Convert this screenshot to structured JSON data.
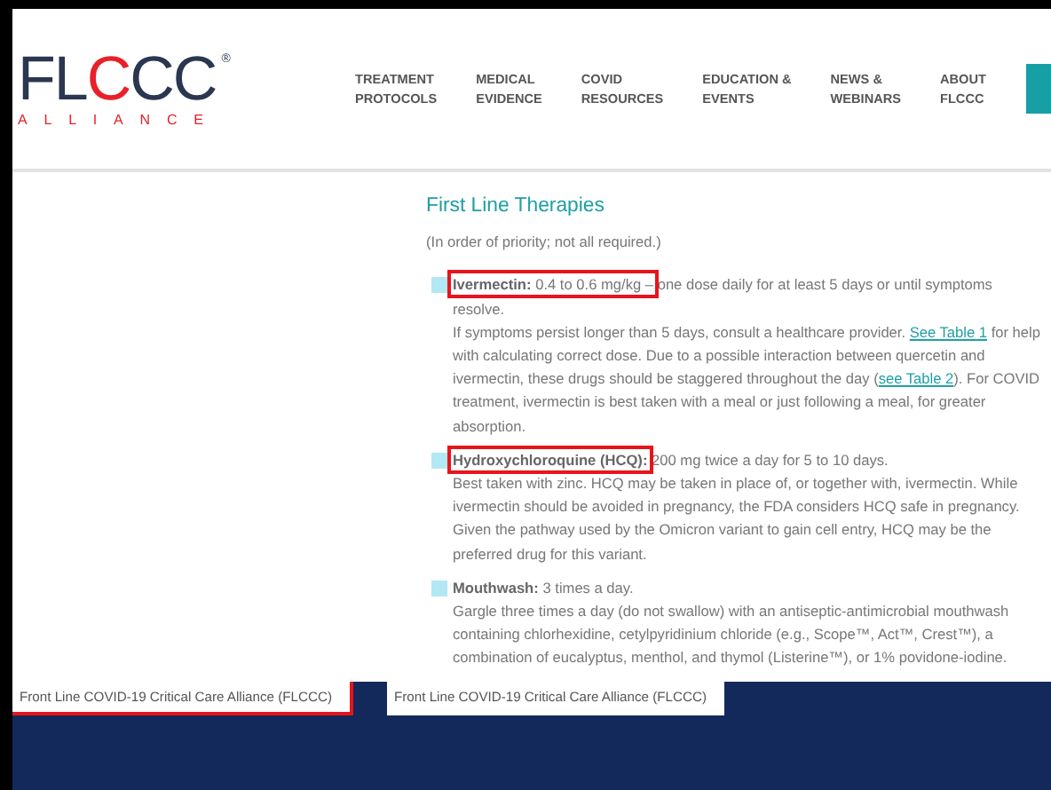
{
  "logo": {
    "wordmark_start": "FL",
    "wordmark_accent": "C",
    "wordmark_end": "CC",
    "registered": "®",
    "tagline": "ALLIANCE"
  },
  "nav": [
    {
      "line1": "TREATMENT",
      "line2": "PROTOCOLS"
    },
    {
      "line1": "MEDICAL",
      "line2": "EVIDENCE"
    },
    {
      "line1": "COVID",
      "line2": "RESOURCES"
    },
    {
      "line1": "EDUCATION &",
      "line2": "EVENTS"
    },
    {
      "line1": "NEWS &",
      "line2": "WEBINARS"
    },
    {
      "line1": "ABOUT",
      "line2": "FLCCC"
    }
  ],
  "section": {
    "title": "First Line Therapies",
    "subtitle": "(In order of priority; not all required.)",
    "items": [
      {
        "name": "Ivermectin:",
        "lead": "0.4 to 0.6 mg/kg –",
        "summary": "one dose daily for at least 5 days or until symptoms resolve.",
        "highlighted": true,
        "details": [
          {
            "kind": "text",
            "text": "If symptoms persist longer than 5 days, consult a healthcare provider. "
          },
          {
            "kind": "link",
            "text": "See Table 1"
          },
          {
            "kind": "text",
            "text": " for help with calculating correct dose. Due to a possible interaction between quercetin and ivermectin, these drugs should be staggered throughout the day ("
          },
          {
            "kind": "link",
            "text": "see Table 2"
          },
          {
            "kind": "text",
            "text": "). For COVID treatment, ivermectin is best taken with a meal or just following a meal, for greater absorption."
          }
        ]
      },
      {
        "name": "Hydroxychloroquine (HCQ):",
        "summary": "200 mg twice a day for 5 to 10 days.",
        "highlighted": true,
        "details": [
          {
            "kind": "text",
            "text": "Best taken with zinc. HCQ may be taken in place of, or together with, ivermectin. While ivermectin should be avoided in pregnancy, the FDA considers HCQ safe in pregnancy. Given the pathway used by the Omicron variant to gain cell entry, HCQ may be the preferred drug for this variant."
          }
        ]
      },
      {
        "name": "Mouthwash:",
        "summary": "3 times a day.",
        "highlighted": false,
        "details": [
          {
            "kind": "text",
            "text": "Gargle three times a day (do not swallow) with an antiseptic-antimicrobial mouthwash containing chlorhexidine, cetylpyridinium chloride (e.g., Scope™, Act™, Crest™), a combination of eucalyptus, menthol, and thymol (Listerine™), or 1% povidone-iodine."
          }
        ]
      }
    ]
  },
  "footer": [
    {
      "text": "Front Line COVID-19 Critical Care Alliance (FLCCC)",
      "highlighted": true
    },
    {
      "text": "Front Line COVID-19 Critical Care Alliance (FLCCC)",
      "highlighted": false
    }
  ]
}
